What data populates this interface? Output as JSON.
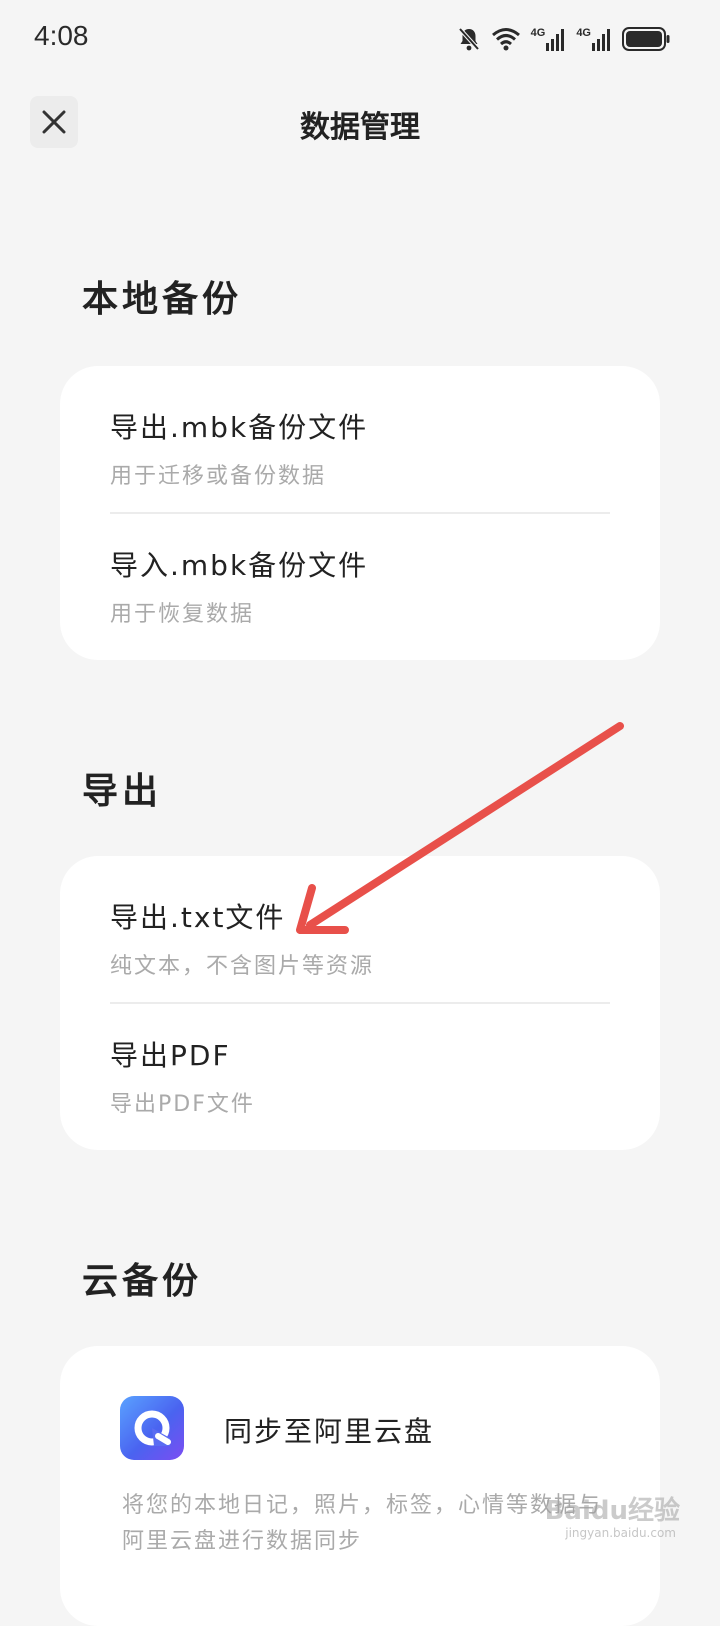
{
  "status_bar": {
    "time": "4:08",
    "network_1": "4G",
    "network_2": "4G"
  },
  "header": {
    "title": "数据管理",
    "close_icon": "close-icon"
  },
  "sections": {
    "local_backup": {
      "title": "本地备份",
      "items": [
        {
          "label": "导出.mbk备份文件",
          "subtitle": "用于迁移或备份数据"
        },
        {
          "label": "导入.mbk备份文件",
          "subtitle": "用于恢复数据"
        }
      ]
    },
    "export": {
      "title": "导出",
      "items": [
        {
          "label": "导出.txt文件",
          "subtitle": "纯文本，不含图片等资源"
        },
        {
          "label": "导出PDF",
          "subtitle": "导出PDF文件"
        }
      ]
    },
    "cloud_backup": {
      "title": "云备份",
      "aliyun": {
        "label": "同步至阿里云盘",
        "description": "将您的本地日记，照片，标签，心情等数据与阿里云盘进行数据同步",
        "icon": "aliyun-drive-icon"
      }
    }
  },
  "annotation": {
    "color": "#e8504a"
  },
  "watermark": {
    "text": "Baidu经验",
    "sub": "jingyan.baidu.com"
  }
}
